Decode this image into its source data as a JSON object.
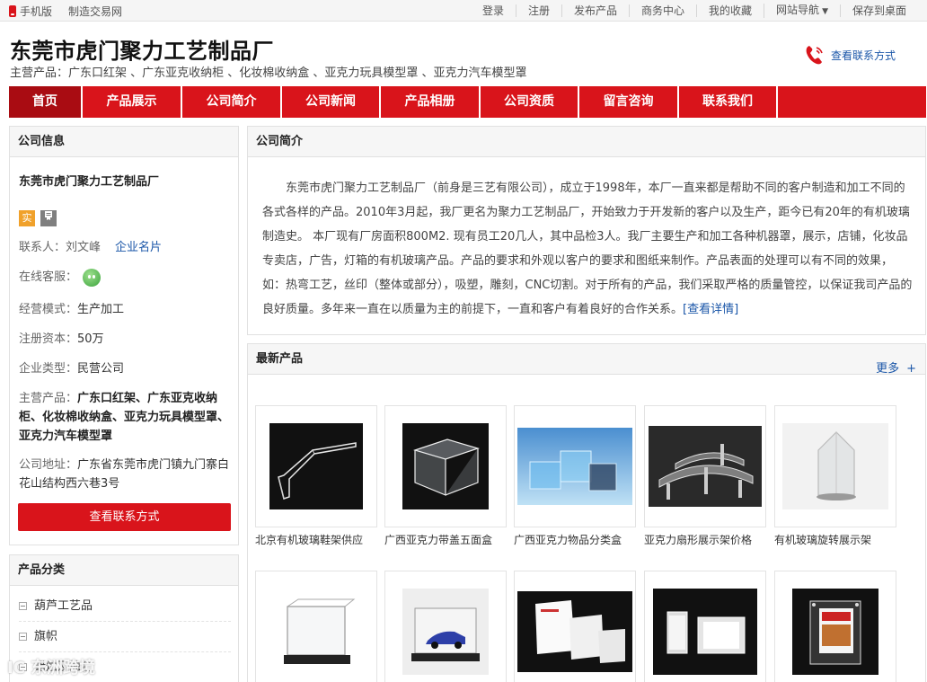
{
  "topbar": {
    "left": [
      "手机版",
      "制造交易网"
    ],
    "right": [
      "登录",
      "注册",
      "发布产品",
      "商务中心",
      "我的收藏",
      "网站导航",
      "保存到桌面"
    ]
  },
  "header": {
    "title": "东莞市虎门聚力工艺制品厂",
    "main_products": "主营产品：广东口红架 、广东亚克收纳柜 、化妆棉收纳盒 、亚克力玩具模型罩 、亚克力汽车模型罩",
    "contact_label": "查看联系方式"
  },
  "nav": {
    "items": [
      "首页",
      "产品展示",
      "公司简介",
      "公司新闻",
      "产品相册",
      "公司资质",
      "留言咨询",
      "联系我们"
    ]
  },
  "company_info": {
    "header": "公司信息",
    "name": "东莞市虎门聚力工艺制品厂",
    "badge_shi": "实",
    "contact_label": "联系人：",
    "contact_name": "刘文峰",
    "card_link": "企业名片",
    "online_label": "在线客服：",
    "mode_label": "经营模式：",
    "mode_value": "生产加工",
    "capital_label": "注册资本：",
    "capital_value": "50万",
    "type_label": "企业类型：",
    "type_value": "民营公司",
    "main_label": "主营产品：",
    "main_value": "广东口红架、广东亚克收纳柜、化妆棉收纳盒、亚克力玩具模型罩、亚克力汽车模型罩",
    "address_label": "公司地址：",
    "address_value": "广东省东莞市虎门镇九门寨白花山结构西六巷3号",
    "button": "查看联系方式"
  },
  "product_categories": {
    "header": "产品分类",
    "items": [
      "葫芦工艺品",
      "旗帜",
      "蜡烛及烛台"
    ]
  },
  "intro": {
    "header": "公司简介",
    "text": "东莞市虎门聚力工艺制品厂（前身是三艺有限公司），成立于1998年，本厂一直来都是帮助不同的客户制造和加工不同的各式各样的产品。2010年3月起，我厂更名为聚力工艺制品厂，开始致力于开发新的客户以及生产，距今已有20年的有机玻璃制造史。 本厂现有厂房面积800M2. 现有员工20几人，其中品检3人。我厂主要生产和加工各种机器罩，展示，店铺，化妆品专卖店，广告，灯箱的有机玻璃产品。产品的要求和外观以客户的要求和图纸来制作。产品表面的处理可以有不同的效果，如：热弯工艺，丝印（整体或部分），吸塑，雕刻，CNC切割。对于所有的产品，我们采取严格的质量管控，以保证我司产品的良好质量。多年来一直在以质量为主的前提下，一直和客户有着良好的合作关系。",
    "more": "[查看详情]"
  },
  "newest": {
    "header": "最新产品",
    "more": "更多",
    "more_plus": "+",
    "products_row1": [
      "北京有机玻璃鞋架供应",
      "广西亚克力带盖五面盒",
      "广西亚克力物品分类盒",
      "亚克力扇形展示架价格",
      "有机玻璃旋转展示架"
    ],
    "products_row2": [
      "",
      "",
      "",
      "",
      ""
    ]
  },
  "watermark": "IC 东洲跨境",
  "colors": {
    "brand_red": "#d9141b",
    "active_red": "#a90c12",
    "link_blue": "#1a56a8"
  }
}
